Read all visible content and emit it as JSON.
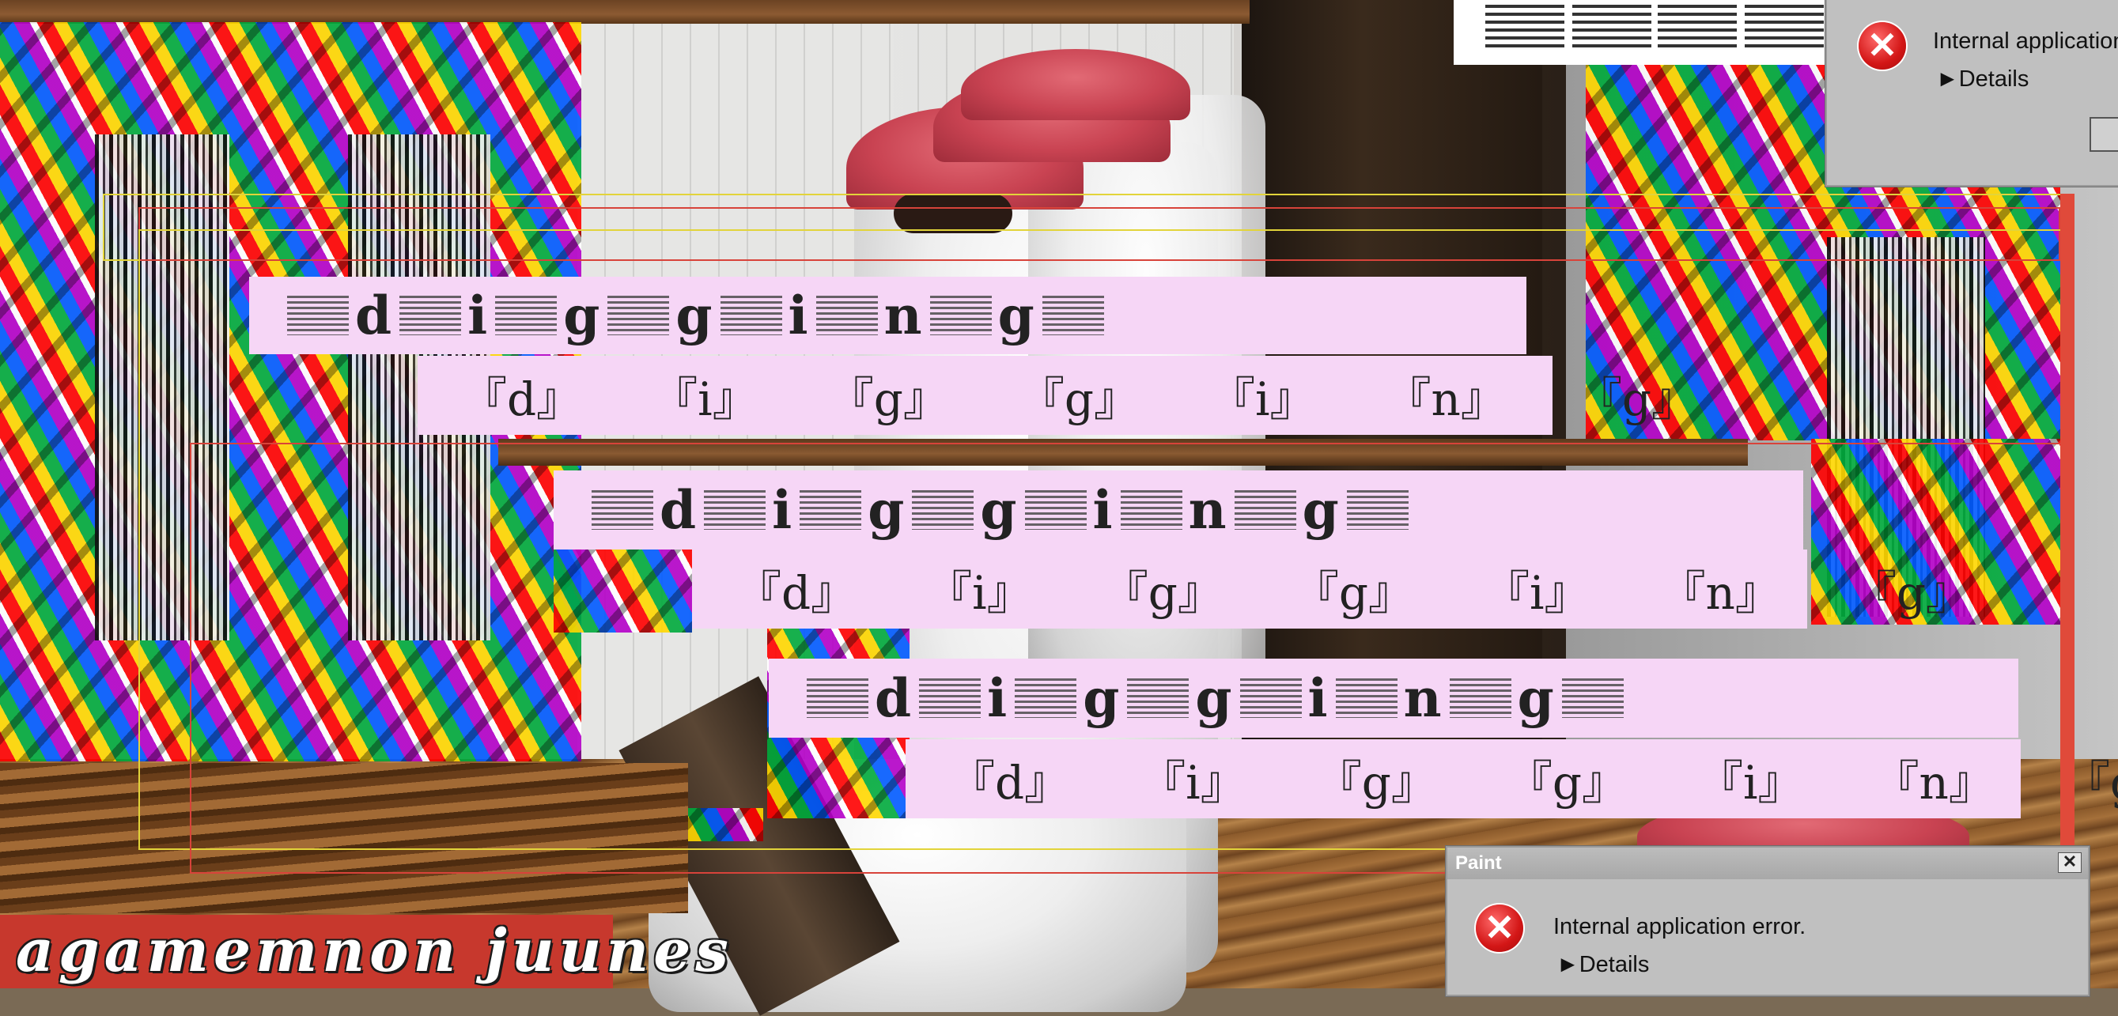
{
  "glitch_text": {
    "dotted_letters": [
      "d",
      "i",
      "g",
      "g",
      "i",
      "n",
      "g"
    ],
    "bracketed_letters": [
      "『d』",
      "『i』",
      "『g』",
      "『g』",
      "『i』",
      "『n』",
      "『g』"
    ]
  },
  "dialogs": {
    "top": {
      "message": "Internal application",
      "details": "►Details"
    },
    "bottom": {
      "title": "Paint",
      "close_glyph": "✕",
      "message": "Internal application error.",
      "details": "►Details"
    }
  },
  "signature": {
    "text": "agamemnon juunes"
  },
  "icons": {
    "error": "error-x-icon",
    "close": "close-icon",
    "alignment": "text-align-icon"
  },
  "colors": {
    "panel_pink": "#f6d6f6",
    "banner_red": "#c7382d",
    "dialog_gray": "#c0c0c0",
    "error_red": "#d31616",
    "outline_yellow": "#e2d43a",
    "outline_red": "#d8433a"
  }
}
